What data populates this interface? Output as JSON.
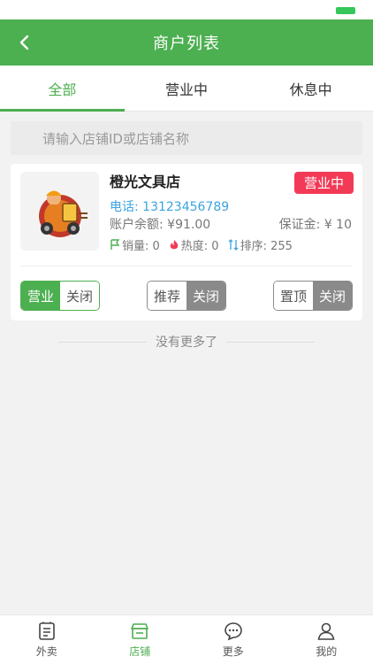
{
  "header": {
    "title": "商户列表"
  },
  "tabs": [
    {
      "label": "全部",
      "active": true
    },
    {
      "label": "营业中",
      "active": false
    },
    {
      "label": "休息中",
      "active": false
    }
  ],
  "search": {
    "placeholder": "请输入店铺ID或店铺名称"
  },
  "shops": [
    {
      "name": "橙光文具店",
      "status": "营业中",
      "phone": "电话: 13123456789",
      "balance": "账户余额: ¥91.00",
      "deposit": "保证金: ¥ 10",
      "sales": "销量: 0",
      "heat": "热度: 0",
      "rank": "排序: 255",
      "toggles": [
        {
          "on_label": "营业",
          "off_label": "关闭",
          "state": "on"
        },
        {
          "on_label": "推荐",
          "off_label": "关闭",
          "state": "off"
        },
        {
          "on_label": "置顶",
          "off_label": "关闭",
          "state": "off"
        }
      ]
    }
  ],
  "footer_text": "没有更多了",
  "tabbar": [
    {
      "label": "外卖",
      "icon": "order-icon",
      "active": false
    },
    {
      "label": "店铺",
      "icon": "shop-icon",
      "active": true
    },
    {
      "label": "更多",
      "icon": "chat-icon",
      "active": false
    },
    {
      "label": "我的",
      "icon": "user-icon",
      "active": false
    }
  ],
  "colors": {
    "primary": "#4caf50",
    "badge": "#f23a57",
    "link": "#3ba4e0"
  }
}
